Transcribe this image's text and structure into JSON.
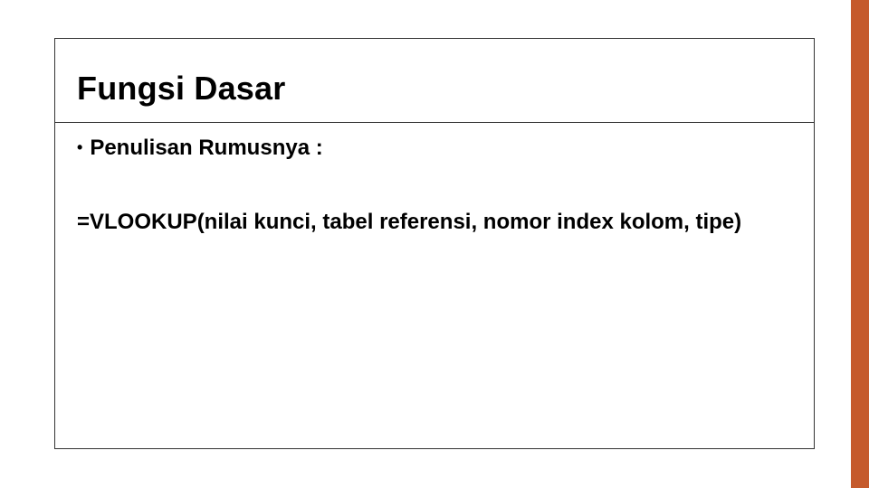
{
  "accent_color": "#c55a2c",
  "slide": {
    "title": "Fungsi Dasar",
    "bullet_marker": "•",
    "bullet_text": "Penulisan Rumusnya :",
    "formula": "=VLOOKUP(nilai kunci, tabel referensi, nomor index kolom, tipe)"
  }
}
